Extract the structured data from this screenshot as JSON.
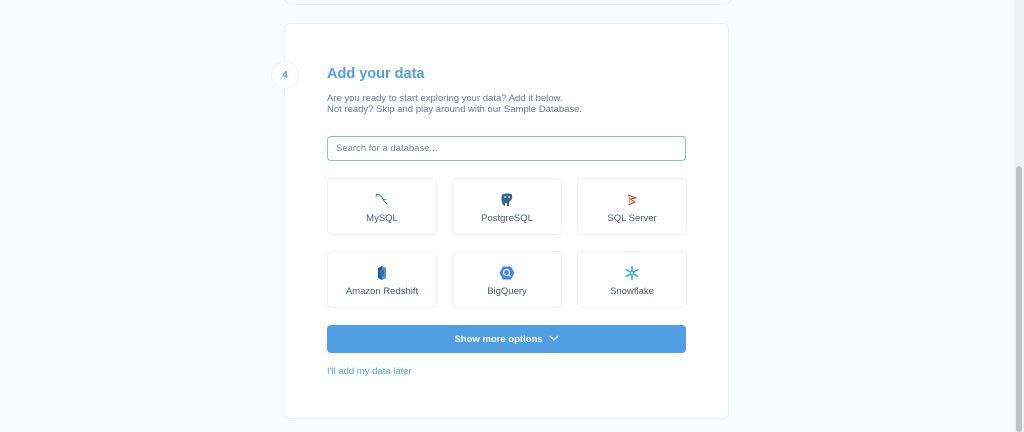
{
  "step": {
    "number": "4",
    "title": "Add your data",
    "description_line1": "Are you ready to start exploring your data? Add it below.",
    "description_line2": "Not ready? Skip and play around with our Sample Database."
  },
  "search": {
    "placeholder": "Search for a database...",
    "value": ""
  },
  "databases": [
    {
      "label": "MySQL",
      "icon": "mysql-dolphin-icon"
    },
    {
      "label": "PostgreSQL",
      "icon": "postgresql-elephant-icon"
    },
    {
      "label": "SQL Server",
      "icon": "sql-server-icon"
    },
    {
      "label": "Amazon Redshift",
      "icon": "redshift-icon"
    },
    {
      "label": "BigQuery",
      "icon": "bigquery-icon"
    },
    {
      "label": "Snowflake",
      "icon": "snowflake-icon"
    }
  ],
  "actions": {
    "show_more_label": "Show more options",
    "add_later_label": "I'll add my data later"
  },
  "colors": {
    "accent": "#509ee3",
    "text": "#4c5773",
    "border": "#eef0f3"
  }
}
